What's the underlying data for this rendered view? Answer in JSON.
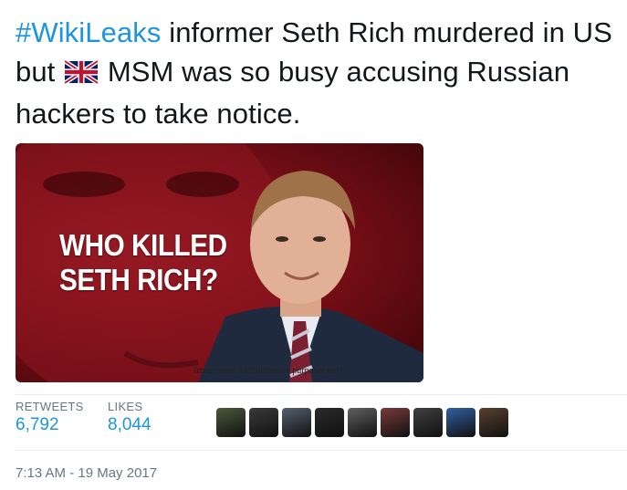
{
  "tweet": {
    "hashtag": "#WikiLeaks",
    "text_part1": " informer Seth Rich murdered in US but ",
    "text_part2": " MSM was so busy accusing Russian hackers to take notice.",
    "flag_icon": "uk-flag-icon"
  },
  "media": {
    "headline_line1": "WHO KILLED",
    "headline_line2": "SETH RICH?",
    "disclaimer": "Image used for illustration purposes only"
  },
  "stats": {
    "retweets_label": "RETWEETS",
    "retweets_value": "6,792",
    "likes_label": "LIKES",
    "likes_value": "8,044"
  },
  "avatars": [
    {
      "name": "avatar-1",
      "color": "#4a5a3a"
    },
    {
      "name": "avatar-2",
      "color": "#3a3a3a"
    },
    {
      "name": "avatar-3",
      "color": "#556070"
    },
    {
      "name": "avatar-4",
      "color": "#2a2a2a"
    },
    {
      "name": "avatar-5",
      "color": "#606060"
    },
    {
      "name": "avatar-6",
      "color": "#7a3a3a"
    },
    {
      "name": "avatar-7",
      "color": "#404040"
    },
    {
      "name": "avatar-8",
      "color": "#3060a0"
    },
    {
      "name": "avatar-9",
      "color": "#5a4030"
    }
  ],
  "timestamp": "7:13 AM - 19 May 2017",
  "colors": {
    "link": "#1b95e0",
    "meta": "#657786",
    "text": "#14171a",
    "divider": "#e6ecf0"
  }
}
